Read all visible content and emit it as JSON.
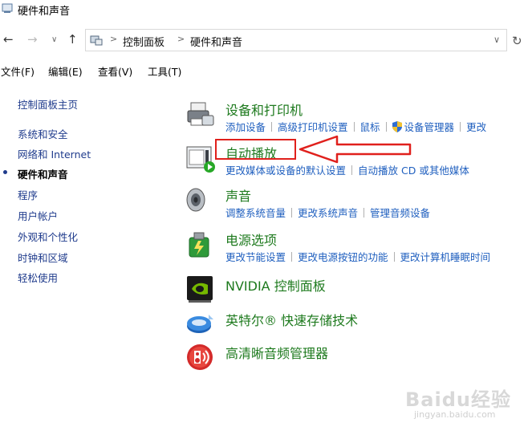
{
  "window": {
    "title": "硬件和声音"
  },
  "address": {
    "breadcrumbs": [
      "控制面板",
      "硬件和声音"
    ]
  },
  "menu": [
    "文件(F)",
    "编辑(E)",
    "查看(V)",
    "工具(T)"
  ],
  "sidebar": {
    "items": [
      {
        "label": "控制面板主页",
        "active": false
      },
      {
        "label": "系统和安全",
        "active": false
      },
      {
        "label": "网络和 Internet",
        "active": false
      },
      {
        "label": "硬件和声音",
        "active": true
      },
      {
        "label": "程序",
        "active": false
      },
      {
        "label": "用户帐户",
        "active": false
      },
      {
        "label": "外观和个性化",
        "active": false
      },
      {
        "label": "时钟和区域",
        "active": false
      },
      {
        "label": "轻松使用",
        "active": false
      }
    ]
  },
  "categories": [
    {
      "title": "设备和打印机",
      "icon": "printer-icon",
      "links": [
        "添加设备",
        "高级打印机设置",
        "鼠标",
        "设备管理器",
        "更改"
      ]
    },
    {
      "title": "自动播放",
      "icon": "autoplay-icon",
      "links": [
        "更改媒体或设备的默认设置",
        "自动播放 CD 或其他媒体"
      ]
    },
    {
      "title": "声音",
      "icon": "speaker-icon",
      "links": [
        "调整系统音量",
        "更改系统声音",
        "管理音频设备"
      ]
    },
    {
      "title": "电源选项",
      "icon": "power-icon",
      "links": [
        "更改节能设置",
        "更改电源按钮的功能",
        "更改计算机睡眠时间"
      ]
    },
    {
      "title": "NVIDIA 控制面板",
      "icon": "nvidia-icon",
      "links": []
    },
    {
      "title": "英特尔® 快速存储技术",
      "icon": "intel-storage-icon",
      "links": []
    },
    {
      "title": "高清晰音频管理器",
      "icon": "audio-manager-icon",
      "links": []
    }
  ],
  "colors": {
    "link": "#1f5fbf",
    "category_title": "#1e7a1e",
    "annotation": "#e0201c"
  },
  "watermark": {
    "brand": "Baidu经验",
    "url": "jingyan.baidu.com"
  }
}
